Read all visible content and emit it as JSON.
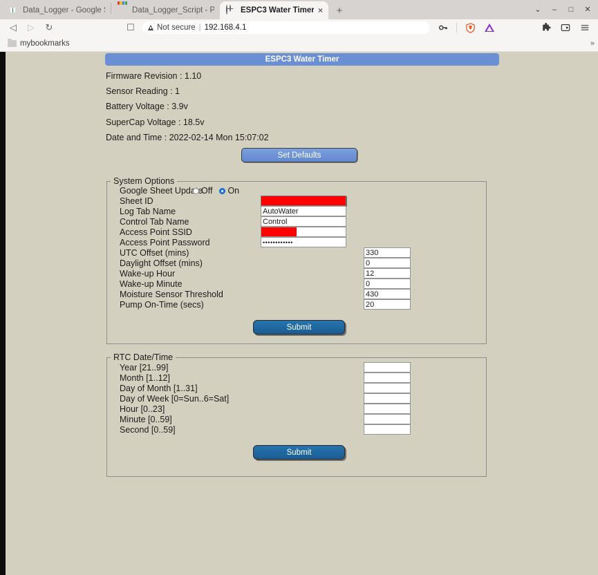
{
  "browser": {
    "tabs": [
      {
        "label": "Data_Logger - Google Sheets",
        "favicon": "google-sheets-icon",
        "active": false
      },
      {
        "label": "Data_Logger_Script - Project E",
        "favicon": "google-apps-script-icon",
        "active": false
      },
      {
        "label": "ESPC3 Water Timer",
        "favicon": "globe-icon",
        "active": true,
        "close_label": "×"
      }
    ],
    "new_tab_label": "+",
    "window_controls": {
      "list": "⌄",
      "minimize": "–",
      "maximize": "□",
      "close": "✕"
    },
    "toolbar": {
      "back_label": "◁",
      "forward_label": "▷",
      "reload_label": "↻",
      "bookmark_label": "☐",
      "security_text": "Not secure",
      "separator": "|",
      "url": "192.168.4.1",
      "password_key_label": "⚷",
      "brave_shield_label": "shield",
      "triangle_label": "triangle",
      "extensions_label": "✱",
      "profile_label": "▣",
      "menu_label": "☰"
    },
    "bookmarks": {
      "items": [
        {
          "label": "mybookmarks",
          "icon": "folder-icon"
        }
      ],
      "overflow_label": "»"
    }
  },
  "page": {
    "title": "ESPC3 Water Timer",
    "info_lines": [
      "Firmware Revision : 1.10",
      "Sensor Reading : 1",
      "Battery Voltage : 3.9v",
      "SuperCap Voltage : 18.5v",
      "Date and Time : 2022-02-14 Mon 15:07:02"
    ],
    "set_defaults_label": "Set Defaults",
    "system_options": {
      "legend": "System Options",
      "google_sheet_update": {
        "label": "Google Sheet Update",
        "options": [
          {
            "label": "Off",
            "checked": false
          },
          {
            "label": "On",
            "checked": true
          }
        ]
      },
      "fields": [
        {
          "label": "Sheet ID",
          "value": "",
          "redacted": "full",
          "type": "text"
        },
        {
          "label": "Log Tab Name",
          "value": "AutoWater",
          "type": "text"
        },
        {
          "label": "Control Tab Name",
          "value": "Control",
          "type": "text"
        },
        {
          "label": "Access Point SSID",
          "value": "",
          "redacted": "partial",
          "type": "text"
        },
        {
          "label": "Access Point Password",
          "value": "••••••••••••",
          "type": "password"
        },
        {
          "label": "UTC Offset (mins)",
          "value": "330",
          "type": "number"
        },
        {
          "label": "Daylight Offset (mins)",
          "value": "0",
          "type": "number"
        },
        {
          "label": "Wake-up Hour",
          "value": "12",
          "type": "number"
        },
        {
          "label": "Wake-up Minute",
          "value": "0",
          "type": "number"
        },
        {
          "label": "Moisture Sensor Threshold",
          "value": "430",
          "type": "number"
        },
        {
          "label": "Pump On-Time (secs)",
          "value": "20",
          "type": "number"
        }
      ],
      "submit_label": "Submit"
    },
    "rtc_datetime": {
      "legend": "RTC Date/Time",
      "fields": [
        {
          "label": "Year [21..99]",
          "value": ""
        },
        {
          "label": "Month [1..12]",
          "value": ""
        },
        {
          "label": "Day of Month [1..31]",
          "value": ""
        },
        {
          "label": "Day of Week [0=Sun..6=Sat]",
          "value": ""
        },
        {
          "label": "Hour [0..23]",
          "value": ""
        },
        {
          "label": "Minute [0..59]",
          "value": ""
        },
        {
          "label": "Second [0..59]",
          "value": ""
        }
      ],
      "submit_label": "Submit"
    }
  },
  "colors": {
    "page_background": "#d4d0c0",
    "title_bar": "#6b8fd4",
    "set_defaults_button": "#6b8fd4",
    "submit_button": "#1b5c93",
    "redaction": "#ff0000",
    "radio_selected": "#1a73e8"
  }
}
